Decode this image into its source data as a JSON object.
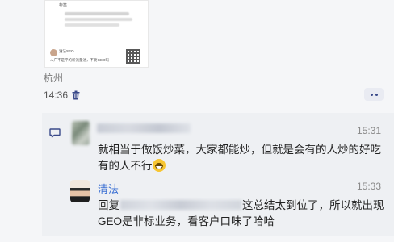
{
  "post_image": {
    "tag": "标签",
    "author": "清法SEO",
    "caption": "人广不是平的新流量池，不要GEO吗"
  },
  "location": "杭州",
  "post_time": "14:36",
  "comment": {
    "timestamp": "15:31",
    "text": "就相当于做饭炒菜，大家都能炒，但就是会有的人炒的好吃有的人不行",
    "emoji": "grinning-face-emoji"
  },
  "reply": {
    "author": "清法",
    "timestamp": "15:33",
    "prefix": "回复",
    "text": "这总结太到位了，所以就出现GEO是非标业务，看客户口味了哈哈"
  },
  "colors": {
    "link_blue": "#3a6fd3",
    "comment_bg": "#eef0f3",
    "icon_blue": "#3a4a8a"
  }
}
